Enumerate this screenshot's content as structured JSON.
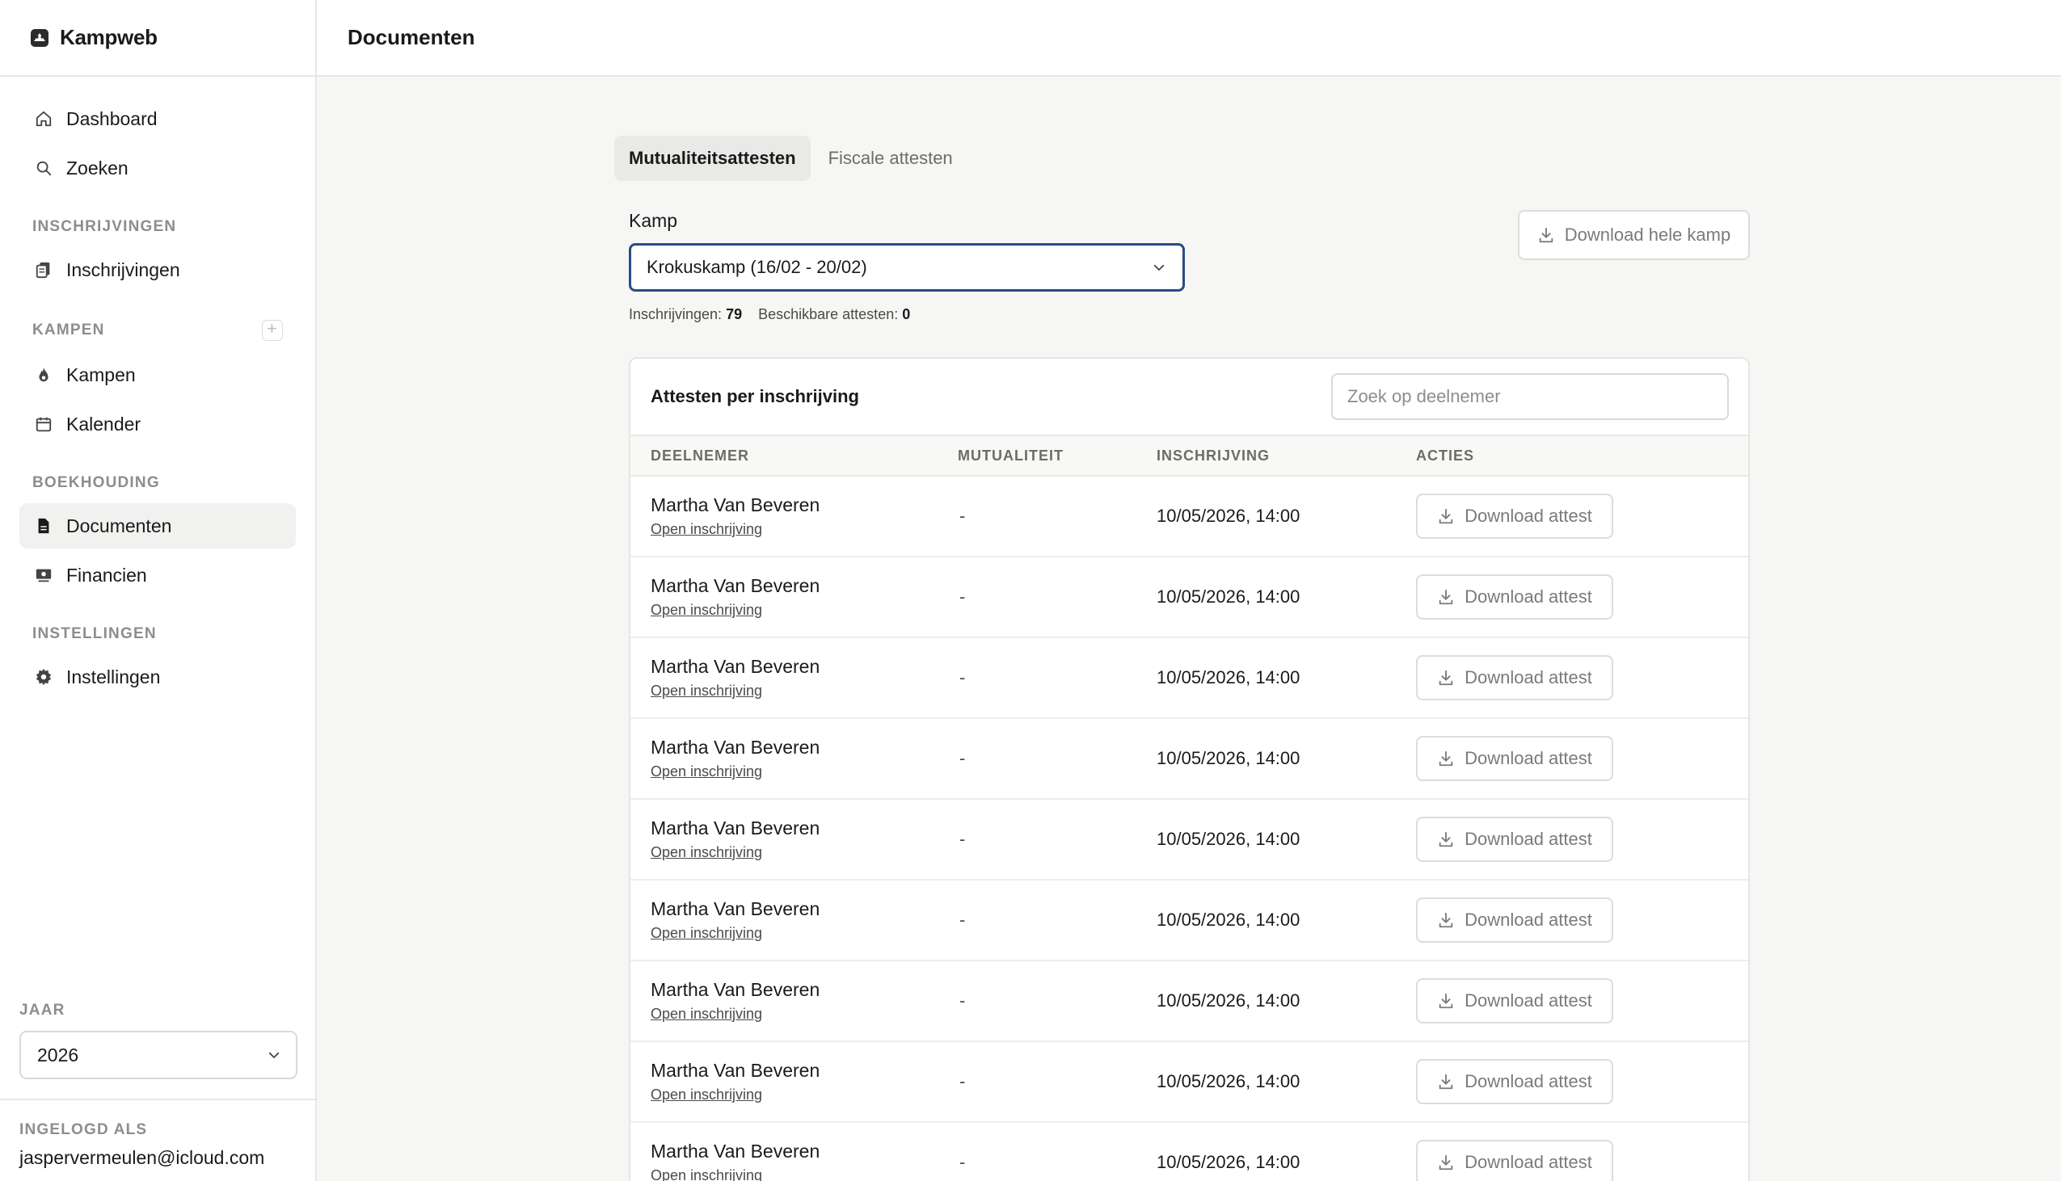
{
  "app": {
    "name": "Kampweb"
  },
  "header": {
    "title": "Documenten"
  },
  "sidebar": {
    "items_top": [
      {
        "label": "Dashboard",
        "icon": "home-icon"
      },
      {
        "label": "Zoeken",
        "icon": "search-icon"
      }
    ],
    "sections": {
      "inschrijvingen": {
        "label": "INSCHRIJVINGEN",
        "item": "Inschrijvingen"
      },
      "kampen": {
        "label": "KAMPEN",
        "items": [
          "Kampen",
          "Kalender"
        ]
      },
      "boekhouding": {
        "label": "BOEKHOUDING",
        "items": [
          "Documenten",
          "Financien"
        ]
      },
      "instellingen": {
        "label": "INSTELLINGEN",
        "item": "Instellingen"
      }
    },
    "active": "Documenten",
    "jaar": {
      "label": "JAAR",
      "value": "2026"
    },
    "user": {
      "label": "INGELOGD ALS",
      "email": "jaspervermeulen@icloud.com"
    }
  },
  "tabs": [
    "Mutualiteitsattesten",
    "Fiscale attesten"
  ],
  "kamp": {
    "label": "Kamp",
    "selected": "Krokuskamp (16/02 - 20/02)",
    "download_label": "Download hele kamp",
    "stats": {
      "inschrijvingen_label": "Inschrijvingen:",
      "inschrijvingen_value": "79",
      "beschikbaar_label": "Beschikbare attesten:",
      "beschikbaar_value": "0"
    }
  },
  "table": {
    "title": "Attesten per inschrijving",
    "search_placeholder": "Zoek op deelnemer",
    "columns": [
      "DEELNEMER",
      "MUTUALITEIT",
      "INSCHRIJVING",
      "ACTIES"
    ],
    "link_label": "Open inschrijving",
    "action_label": "Download attest",
    "rows": [
      {
        "name": "Martha Van Beveren",
        "mutualiteit": "-",
        "inschrijving": "10/05/2026, 14:00"
      },
      {
        "name": "Martha Van Beveren",
        "mutualiteit": "-",
        "inschrijving": "10/05/2026, 14:00"
      },
      {
        "name": "Martha Van Beveren",
        "mutualiteit": "-",
        "inschrijving": "10/05/2026, 14:00"
      },
      {
        "name": "Martha Van Beveren",
        "mutualiteit": "-",
        "inschrijving": "10/05/2026, 14:00"
      },
      {
        "name": "Martha Van Beveren",
        "mutualiteit": "-",
        "inschrijving": "10/05/2026, 14:00"
      },
      {
        "name": "Martha Van Beveren",
        "mutualiteit": "-",
        "inschrijving": "10/05/2026, 14:00"
      },
      {
        "name": "Martha Van Beveren",
        "mutualiteit": "-",
        "inschrijving": "10/05/2026, 14:00"
      },
      {
        "name": "Martha Van Beveren",
        "mutualiteit": "-",
        "inschrijving": "10/05/2026, 14:00"
      },
      {
        "name": "Martha Van Beveren",
        "mutualiteit": "-",
        "inschrijving": "10/05/2026, 14:00"
      }
    ]
  },
  "colors": {
    "accent": "#2b4a86",
    "border": "#e5e5e3",
    "background": "#f6f6f5"
  }
}
